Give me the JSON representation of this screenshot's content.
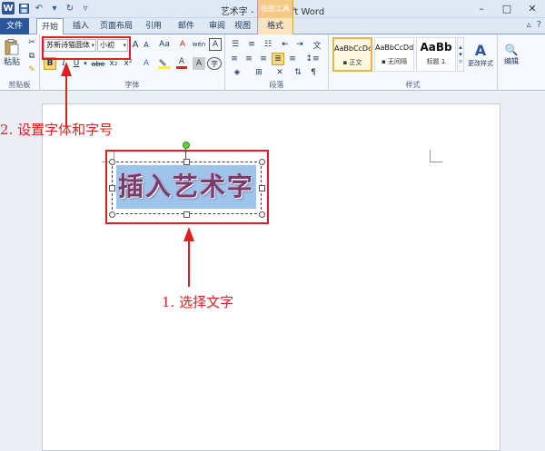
{
  "window": {
    "title": "艺术字 - Microsoft Word",
    "context_tab_group": "绘图工具"
  },
  "tabs": [
    {
      "label": "文件"
    },
    {
      "label": "开始"
    },
    {
      "label": "插入"
    },
    {
      "label": "页面布局"
    },
    {
      "label": "引用"
    },
    {
      "label": "邮件"
    },
    {
      "label": "审阅"
    },
    {
      "label": "视图"
    },
    {
      "label": "格式"
    }
  ],
  "ribbon": {
    "clipboard": {
      "paste_label": "粘贴",
      "group_label": "剪贴板"
    },
    "font": {
      "font_name": "苏新诗猫圆体",
      "font_size": "小初",
      "group_label": "字体",
      "buttons": {
        "bold": "B",
        "italic": "I",
        "underline": "U",
        "strike": "abe",
        "subscript": "x₂",
        "superscript": "x²",
        "grow": "A",
        "shrink": "A",
        "case": "Aa",
        "clear": "A",
        "phonetic": "wén",
        "border": "A",
        "color": "A",
        "shade": "A",
        "enclose": "字"
      }
    },
    "paragraph": {
      "group_label": "段落"
    },
    "styles": {
      "group_label": "样式",
      "items": [
        {
          "sample": "AaBbCcDd",
          "name": "▪ 正文"
        },
        {
          "sample": "AaBbCcDd",
          "name": "▪ 无间隔"
        },
        {
          "sample": "AaBb",
          "name": "标题 1"
        }
      ],
      "change_styles_label": "更改样式"
    },
    "editing": {
      "label": "编辑"
    }
  },
  "document": {
    "art_text": "插入艺术字"
  },
  "annotations": {
    "step1": "1. 选择文字",
    "step2": "2. 设置字体和字号"
  },
  "colors": {
    "annotation_red": "#e02020",
    "selection_blue": "#9fc4ec",
    "art_text_color": "#7a3c70",
    "ribbon_blue": "#2b579a"
  }
}
